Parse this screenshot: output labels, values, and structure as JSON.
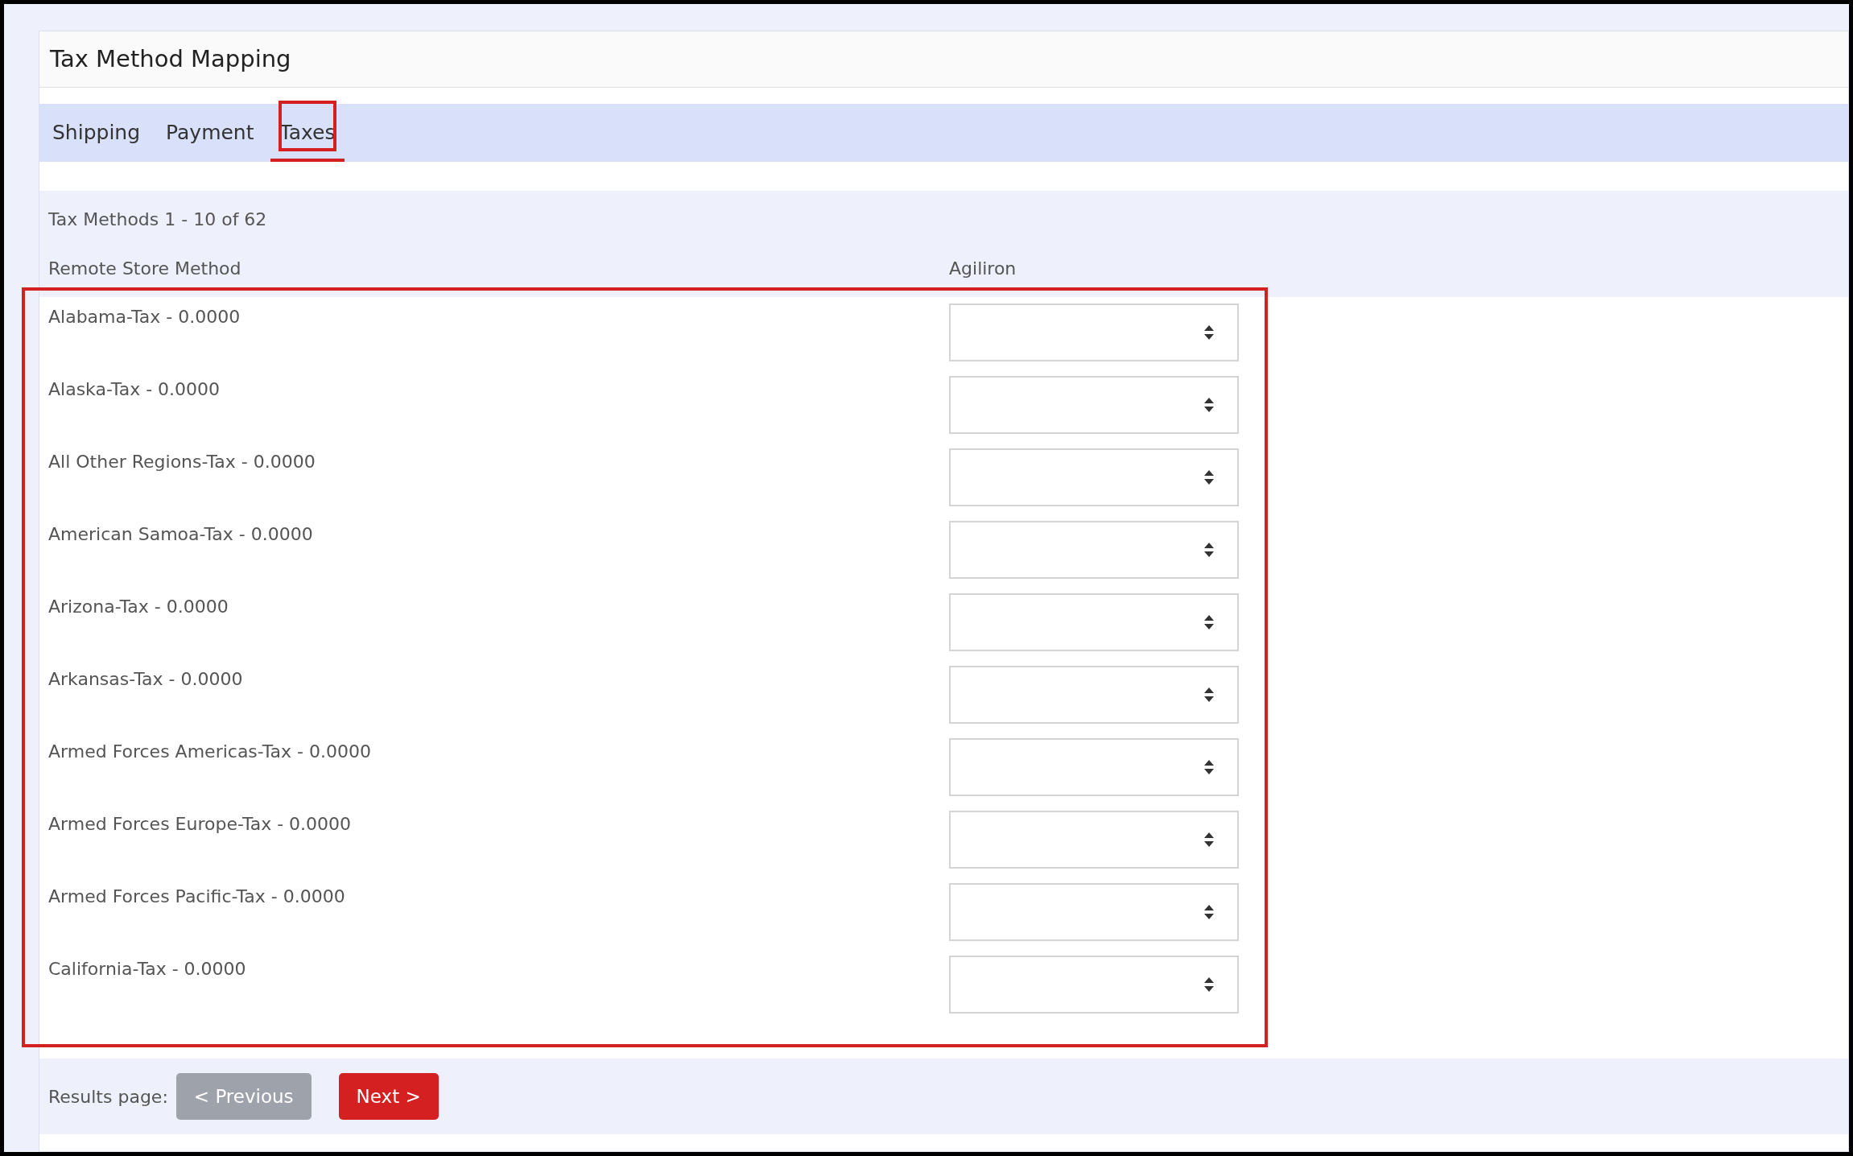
{
  "card": {
    "title": "Tax Method Mapping"
  },
  "tabs": [
    {
      "label": "Shipping",
      "selected": false,
      "highlighted": false
    },
    {
      "label": "Payment",
      "selected": false,
      "highlighted": false
    },
    {
      "label": "Taxes",
      "selected": true,
      "highlighted": true
    }
  ],
  "summary": "Tax Methods 1 - 10 of 62",
  "table": {
    "highlighted": true,
    "columns": [
      "Remote Store Method",
      "Agiliron"
    ],
    "rows": [
      {
        "method": "Alabama-Tax - 0.0000"
      },
      {
        "method": "Alaska-Tax - 0.0000"
      },
      {
        "method": "All Other Regions-Tax - 0.0000"
      },
      {
        "method": "American Samoa-Tax - 0.0000"
      },
      {
        "method": "Arizona-Tax - 0.0000"
      },
      {
        "method": "Arkansas-Tax - 0.0000"
      },
      {
        "method": "Armed Forces Americas-Tax - 0.0000"
      },
      {
        "method": "Armed Forces Europe-Tax - 0.0000"
      },
      {
        "method": "Armed Forces Pacific-Tax - 0.0000"
      },
      {
        "method": "California-Tax - 0.0000"
      }
    ]
  },
  "pagination": {
    "label": "Results page:",
    "buttons": [
      {
        "kind": "previous",
        "label": "< Previous",
        "disabled": true
      },
      {
        "kind": "next",
        "label": "Next >",
        "disabled": false
      }
    ]
  }
}
